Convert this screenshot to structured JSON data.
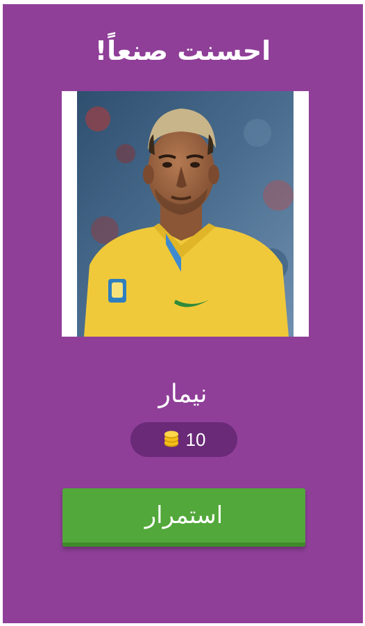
{
  "header": {
    "title": "احسنت صنعاً!"
  },
  "quiz": {
    "photo_alt": "نيمار",
    "answer": "نيمار"
  },
  "reward": {
    "coins": "10",
    "icon": "coin-stack-icon",
    "coin_color": "#f2c01a"
  },
  "actions": {
    "continue_label": "استمرار"
  },
  "colors": {
    "background": "#8f3f98",
    "pill": "#6a2a78",
    "button": "#52a83a"
  }
}
